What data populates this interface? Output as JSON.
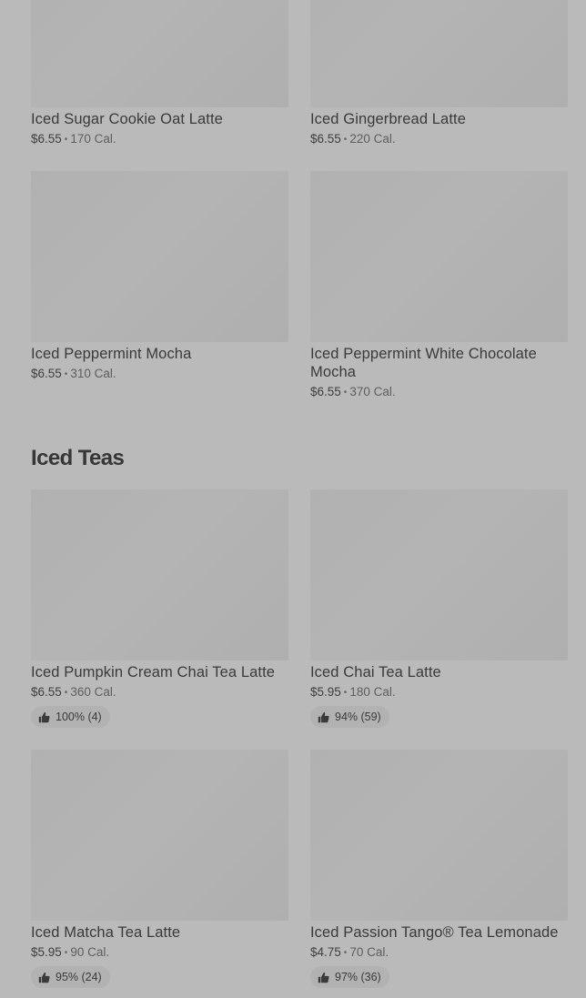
{
  "row1": [
    {
      "name": "Iced Sugar Cookie Oat Latte",
      "price": "$6.55",
      "calories": "170 Cal."
    },
    {
      "name": "Iced Gingerbread Latte",
      "price": "$6.55",
      "calories": "220 Cal."
    }
  ],
  "row2": [
    {
      "name": "Iced Peppermint Mocha",
      "price": "$6.55",
      "calories": "310 Cal."
    },
    {
      "name": "Iced Peppermint White Chocolate Mocha",
      "price": "$6.55",
      "calories": "370 Cal."
    }
  ],
  "iced_teas": {
    "title": "Iced Teas",
    "items": [
      {
        "name": "Iced Pumpkin Cream Chai Tea Latte",
        "price": "$6.55",
        "calories": "360 Cal.",
        "rating": "100% (4)"
      },
      {
        "name": "Iced Chai Tea Latte",
        "price": "$5.95",
        "calories": "180 Cal.",
        "rating": "94% (59)"
      },
      {
        "name": "Iced Matcha Tea Latte",
        "price": "$5.95",
        "calories": "90 Cal.",
        "rating": "95% (24)"
      },
      {
        "name": "Iced Passion Tango® Tea Lemonade",
        "price": "$4.75",
        "calories": "70 Cal.",
        "rating": "97% (36)"
      }
    ]
  },
  "separator": "•",
  "icons": {
    "rating": "thumbs-up-icon"
  }
}
